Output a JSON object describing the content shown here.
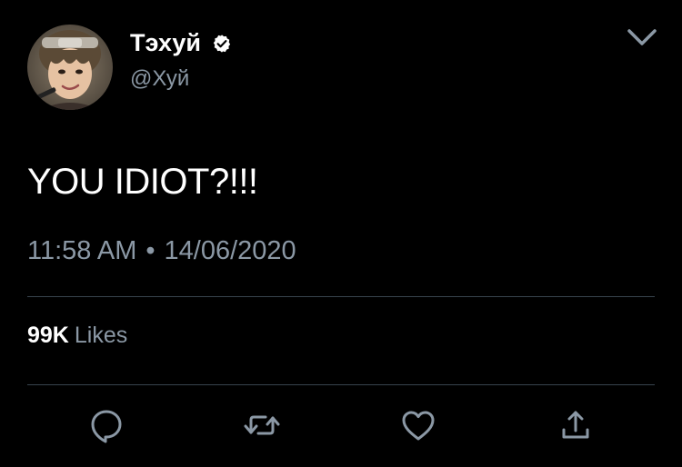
{
  "tweet": {
    "author": {
      "display_name": "Тэхуй",
      "handle": "@Хуй",
      "verified": true,
      "avatar": "profile-photo"
    },
    "text": "YOU IDIOT?!!!",
    "time": "11:58 AM",
    "separator": "•",
    "date": "14/06/2020",
    "likes": {
      "count": "99K",
      "label": "Likes"
    },
    "menu_icon": "chevron-down-icon",
    "actions": [
      {
        "icon": "reply-icon"
      },
      {
        "icon": "retweet-icon"
      },
      {
        "icon": "like-icon"
      },
      {
        "icon": "share-icon"
      }
    ]
  },
  "colors": {
    "background": "#000000",
    "text": "#ffffff",
    "secondary": "#8b98a5",
    "divider": "#38444d",
    "verified_badge": "#ffffff"
  }
}
